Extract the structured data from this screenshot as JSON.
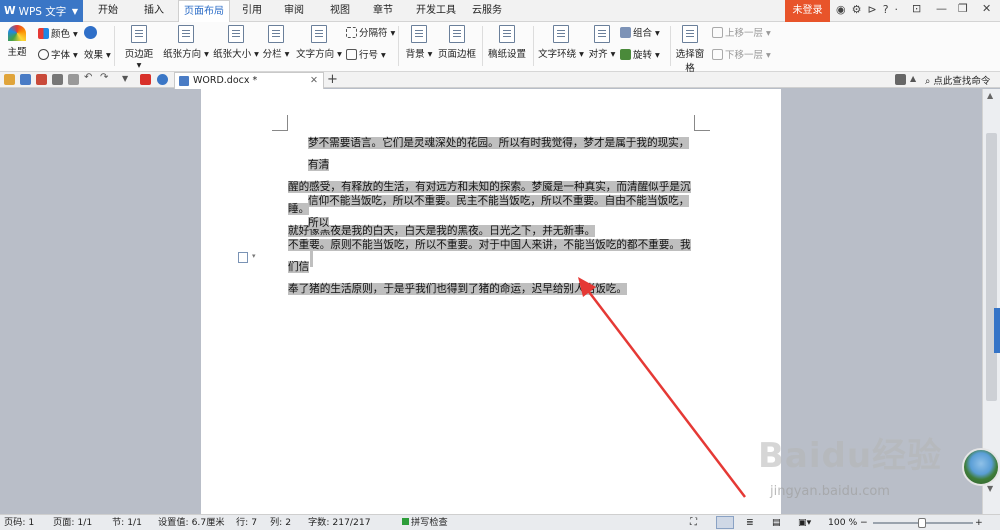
{
  "app": {
    "title": "WPS 文字"
  },
  "tabs": [
    "开始",
    "插入",
    "页面布局",
    "引用",
    "审阅",
    "视图",
    "章节",
    "开发工具",
    "云服务"
  ],
  "active_tab_index": 2,
  "login_label": "未登录",
  "ribbon": {
    "theme": "主题",
    "colors": "颜色",
    "font": "字体",
    "effects": "效果",
    "margins": "页边距",
    "orientation": "纸张方向",
    "size": "纸张大小",
    "columns": "分栏",
    "text_direction": "文字方向",
    "separator": "分隔符",
    "line_numbers": "行号",
    "background": "背景",
    "page_border": "页面边框",
    "manuscript": "稿纸设置",
    "text_wrap": "文字环绕",
    "align": "对齐",
    "group": "组合",
    "rotate": "旋转",
    "selection_pane": "选择窗格",
    "bring_forward": "上移一层",
    "send_backward": "下移一层"
  },
  "document_tab": {
    "name": "WORD.docx *"
  },
  "command_search": "点此查找命令",
  "document": {
    "paragraph1_lines": [
      "梦不需要语言。它们是灵魂深处的花园。所以有时我觉得，梦才是属于我的现实，有清",
      "醒的感受，有释放的生活，有对远方和未知的探索。梦魇是一种真实，而清醒似乎是沉睡。",
      "就好像黑夜是我的白天，白天是我的黑夜。日光之下，并无新事。"
    ],
    "paragraph2_lines": [
      "信仰不能当饭吃，所以不重要。民主不能当饭吃，所以不重要。自由不能当饭吃，所以",
      "不重要。原则不能当饭吃，所以不重要。对于中国人来讲，不能当饭吃的都不重要。我们信",
      "奉了猪的生活原则，于是乎我们也得到了猪的命运，迟早给别人当饭吃。"
    ]
  },
  "status": {
    "page_code": "页码: 1",
    "page": "页面: 1/1",
    "section": "节: 1/1",
    "setting": "设置值: 6.7厘米",
    "row": "行: 7",
    "col": "列: 2",
    "words": "字数: 217/217",
    "spell": "拼写检查",
    "zoom": "100 %"
  },
  "watermark": {
    "logo": "Baidu经验",
    "url": "jingyan.baidu.com"
  },
  "colors": {
    "accent": "#3a76c6",
    "login": "#e8542a",
    "arrow": "#e53935",
    "selection": "#bfbfbf"
  }
}
